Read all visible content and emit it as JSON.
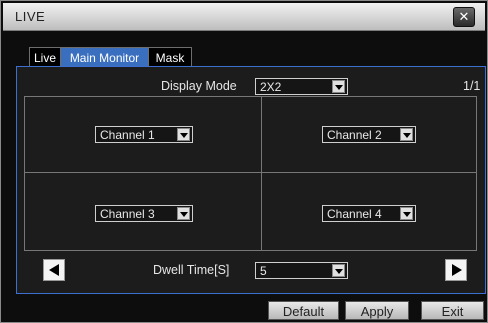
{
  "window": {
    "title": "LIVE"
  },
  "tabs": [
    {
      "label": "Live"
    },
    {
      "label": "Main Monitor"
    },
    {
      "label": "Mask"
    }
  ],
  "display_mode": {
    "label": "Display Mode",
    "value": "2X2"
  },
  "page_indicator": "1/1",
  "channels": [
    {
      "value": "Channel 1"
    },
    {
      "value": "Channel 2"
    },
    {
      "value": "Channel 3"
    },
    {
      "value": "Channel 4"
    }
  ],
  "dwell_time": {
    "label": "Dwell Time[S]",
    "value": "5"
  },
  "buttons": {
    "default": "Default",
    "apply": "Apply",
    "exit": "Exit"
  },
  "icons": {
    "close": "close-icon",
    "prev": "prev-arrow-icon",
    "next": "next-arrow-icon"
  },
  "colors": {
    "active_tab": "#3a6fc0",
    "panel_border": "#3c6fd0",
    "background": "#0d0d0d"
  }
}
